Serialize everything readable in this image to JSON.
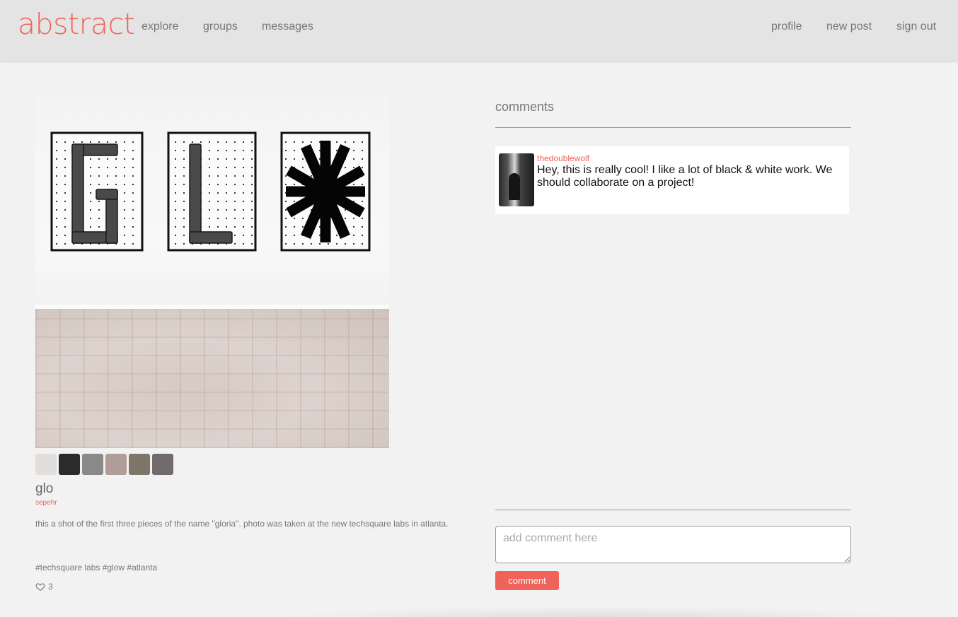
{
  "header": {
    "logo": "abstract",
    "nav_left": [
      "explore",
      "groups",
      "messages"
    ],
    "nav_right": [
      "profile",
      "new post",
      "sign out"
    ]
  },
  "post": {
    "palette": [
      "#e1dedc",
      "#2b2b2b",
      "#898989",
      "#b19d97",
      "#807569",
      "#716b6c"
    ],
    "title": "glo",
    "author": "sepehr",
    "description": "this a shot of the first three pieces of the name \"gloria\". photo was taken at the new techsquare labs in atlanta.",
    "tags": "#techsquare labs #glow #atlanta",
    "likes": "3"
  },
  "comments": {
    "heading": "comments",
    "items": [
      {
        "user": "thedoublewolf",
        "text": "Hey, this is really cool! I like a lot of black & white work. We should collaborate on a project!"
      }
    ],
    "input_placeholder": "add comment here",
    "submit_label": "comment"
  },
  "colors": {
    "accent": "#f0635a",
    "header_bg": "#e4e4e4",
    "page_bg": "#f2f2f2"
  }
}
